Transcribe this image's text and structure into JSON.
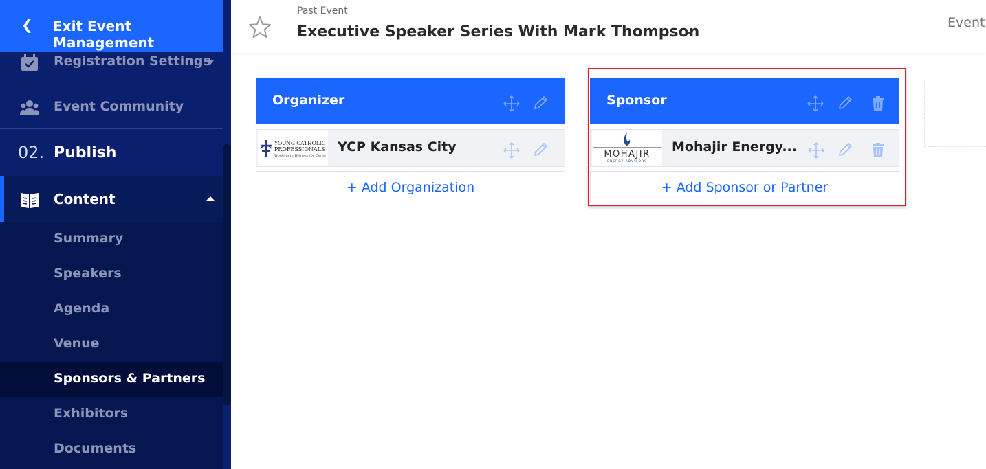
{
  "sidebar": {
    "exit_label": "Exit Event Management",
    "registration_settings": "Registration Settings",
    "event_community": "Event Community",
    "publish_number": "02.",
    "publish_label": "Publish",
    "content_label": "Content",
    "sub_items": [
      "Summary",
      "Speakers",
      "Agenda",
      "Venue",
      "Sponsors & Partners",
      "Exhibitors",
      "Documents"
    ],
    "active_item": "Sponsors & Partners"
  },
  "header": {
    "status": "Past Event",
    "title": "Executive Speaker Series With Mark Thompson",
    "right_text": "Event"
  },
  "cards": [
    {
      "title": "Organizer",
      "row_name": "YCP Kansas City",
      "logo_lines": [
        "YOUNG CATHOLIC",
        "PROFESSIONALS",
        "Working in Witness for Christ"
      ],
      "add_label": "+ Add Organization"
    },
    {
      "title": "Sponsor",
      "row_name": "Mohajir Energy...",
      "logo_lines": [
        "MOHAJIR",
        "ENERGY ADVISORS"
      ],
      "add_label": "+ Add Sponsor or Partner"
    }
  ],
  "colors": {
    "primary": "#1a66ff",
    "sidebar": "#0a1f6e",
    "highlight": "#e0202a"
  }
}
